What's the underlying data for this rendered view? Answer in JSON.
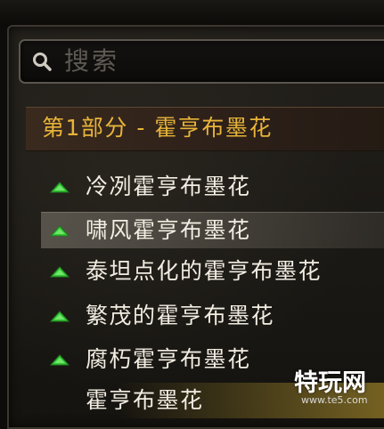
{
  "search": {
    "placeholder": "搜索"
  },
  "section": {
    "title": "第1部分 - 霍亨布墨花"
  },
  "items": [
    {
      "label": "冷冽霍亨布墨花"
    },
    {
      "label": "啸风霍亨布墨花",
      "selected": true
    },
    {
      "label": "泰坦点化的霍亨布墨花"
    },
    {
      "label": "繁茂的霍亨布墨花"
    },
    {
      "label": "腐朽霍亨布墨花"
    },
    {
      "label": "霍亨布墨花"
    }
  ],
  "watermark": {
    "text": "特玩网",
    "url": "www.te5.com"
  },
  "colors": {
    "section_title": "#e8b43a",
    "arrow": "#3fcf3a",
    "item_text": "#f2ede2"
  },
  "icons": {
    "search": "magnifier-icon",
    "item_marker": "green-up-arrow-icon"
  }
}
